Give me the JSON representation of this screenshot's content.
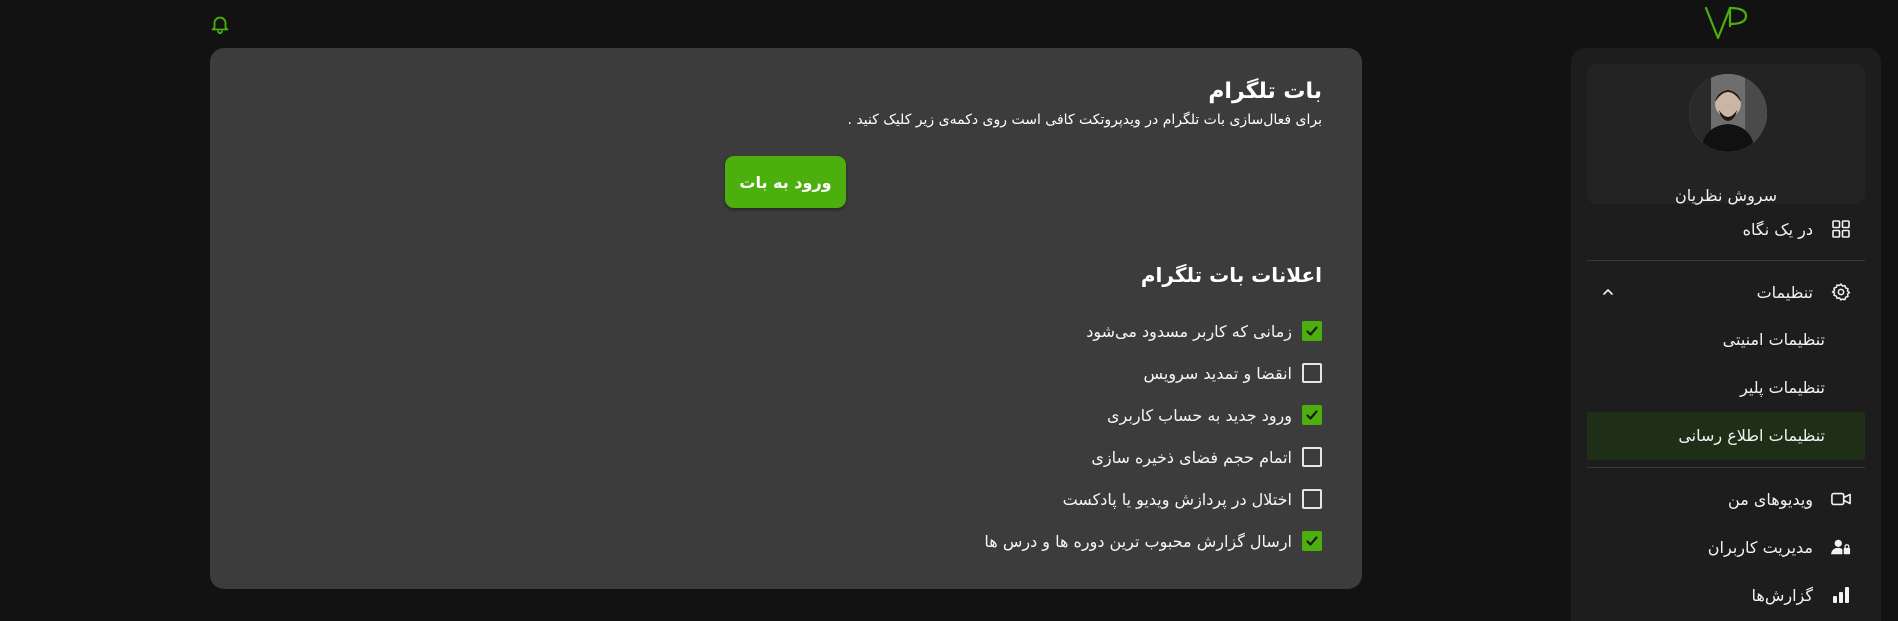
{
  "header": {
    "bell_icon": "bell-icon",
    "logo_text": "VP"
  },
  "telegram_bot": {
    "title": "بات تلگرام",
    "description": "برای فعال‌سازی بات تلگرام در ویدپروتکت کافی است روی دکمه‌ی زیر کلیک کنید .",
    "button_label": "ورود به بات"
  },
  "notifications": {
    "title": "اعلانات بات تلگرام",
    "items": [
      {
        "label": "زمانی که کاربر مسدود می‌شود",
        "checked": true
      },
      {
        "label": "انقضا و تمدید سرویس",
        "checked": false
      },
      {
        "label": "ورود جدید به حساب کاربری",
        "checked": true
      },
      {
        "label": "اتمام حجم فضای ذخیره سازی",
        "checked": false
      },
      {
        "label": "اختلال در پردازش ویدیو یا پادکست",
        "checked": false
      },
      {
        "label": "ارسال گزارش محبوب ترین دوره ها و درس ها",
        "checked": true
      }
    ]
  },
  "sidebar": {
    "profile_name": "سروش نظریان",
    "items": [
      {
        "label": "در یک نگاه",
        "icon": "dashboard-grid-icon"
      },
      {
        "label": "تنظیمات",
        "icon": "gear-icon"
      },
      {
        "label": "تنظیمات امنیتی"
      },
      {
        "label": "تنظیمات پلیر"
      },
      {
        "label": "تنظیمات اطلاع رسانی",
        "active": true
      },
      {
        "label": "ویدیوهای من",
        "icon": "video-camera-icon"
      },
      {
        "label": "مدیریت کاربران",
        "icon": "user-lock-icon"
      },
      {
        "label": "گزارش‌ها",
        "icon": "bar-chart-icon"
      }
    ]
  },
  "colors": {
    "accent": "#4caf0e",
    "card": "#3c3c3c",
    "background": "#121212",
    "sidebar": "#1d1d1d",
    "active_item": "#1f2e16"
  }
}
